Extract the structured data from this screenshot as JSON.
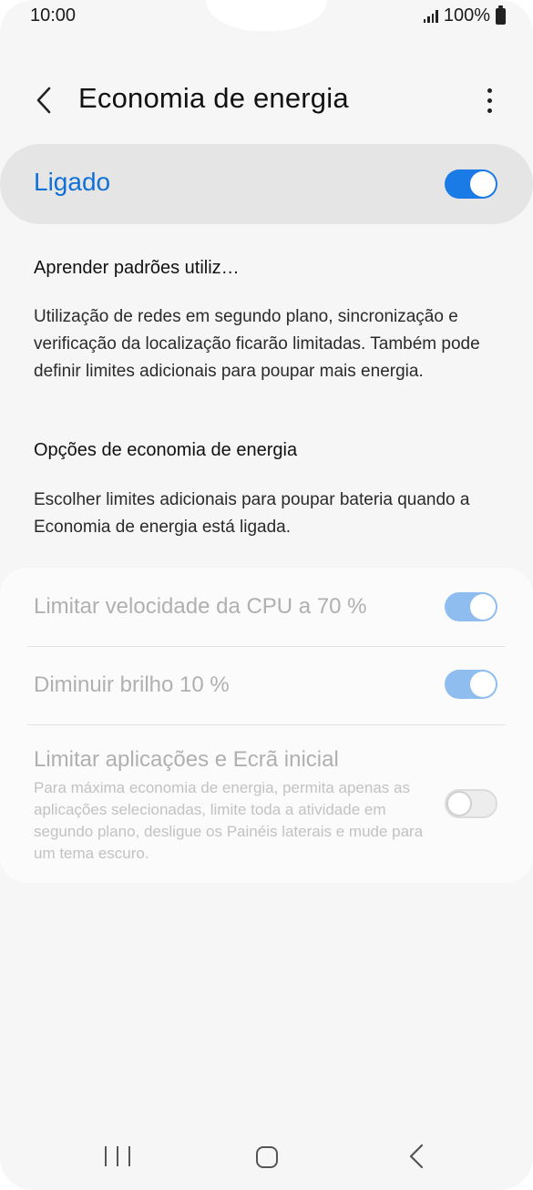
{
  "status_bar": {
    "time": "10:00",
    "battery_percent": "100%",
    "icons": [
      "signal-icon",
      "battery-icon"
    ]
  },
  "app_bar": {
    "title": "Economia de energia",
    "back_icon": "chevron-left-icon",
    "more_icon": "more-vertical-icon"
  },
  "master_switch": {
    "label": "Ligado",
    "on": true,
    "accent": "#1170d6"
  },
  "sections": [
    {
      "heading": "Aprender padrões utiliz…",
      "text": "Utilização de redes em segundo plano, sincronização e verificação da localização ficarão limitadas. Também pode definir limites adicionais para poupar mais energia."
    },
    {
      "heading": "Opções de economia de energia",
      "text": "Escolher limites adicionais para poupar bateria quando a Economia de energia está ligada."
    }
  ],
  "options": [
    {
      "title": "Limitar velocidade da CPU a 70 %",
      "description": "",
      "on": true
    },
    {
      "title": "Diminuir brilho 10 %",
      "description": "",
      "on": true
    },
    {
      "title": "Limitar aplicações e Ecrã inicial",
      "description": "Para máxima economia de energia, permita apenas as aplicações selecionadas, limite toda a atividade em segundo plano, desligue os Painéis laterais e mude para um tema escuro.",
      "on": false
    }
  ],
  "nav_bar": {
    "icons": [
      "recent-apps-icon",
      "home-icon",
      "back-icon"
    ]
  }
}
